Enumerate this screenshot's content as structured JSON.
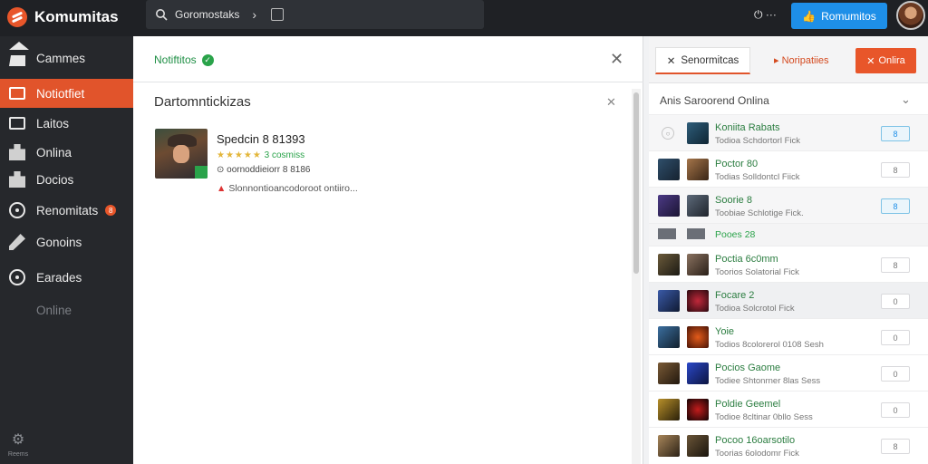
{
  "topbar": {
    "brand": "Komumitas",
    "search_text": "Goromostaks",
    "search_chevron": "›",
    "icons": [
      "power-icon",
      "more-icon"
    ],
    "icons_text": "⏻ ⋯",
    "primary_button": "Romumitos",
    "accent": "#1e8fe8"
  },
  "sidebar": {
    "items": [
      {
        "label": "Cammes",
        "icon": "home-icon"
      },
      {
        "label": "Notiotfiet",
        "icon": "notes-icon"
      },
      {
        "label": "Laitos",
        "icon": "square-icon"
      },
      {
        "label": "Onlina",
        "icon": "puzzle-icon"
      },
      {
        "label": "Docios",
        "icon": "puzzle-icon"
      },
      {
        "label": "Renomitats",
        "icon": "ring-icon",
        "badge": "8"
      },
      {
        "label": "Gonoins",
        "icon": "pencil-icon"
      },
      {
        "label": "Earades",
        "icon": "circle-icon"
      },
      {
        "label": "Online",
        "icon": ""
      }
    ],
    "settings_label": "Reems",
    "accent": "#e1542b"
  },
  "main": {
    "header_title": "Notiftitos",
    "section_title": "Dartomntickizas",
    "game": {
      "name": "Spedcin 8 81393",
      "stars": "★★★★★",
      "rating_text": "3 cosmiss",
      "meta": "⊙ oornoddieiorr 8 8186",
      "note_icon": "▲",
      "note": "Slonnontioancodoroot ontiiro..."
    }
  },
  "right": {
    "tabs": [
      "Senormitcas",
      "Noripatiies",
      "Onlira"
    ],
    "header": "Anis  Saroorend Onlina",
    "rows": [
      {
        "name": "Koniita Rabats",
        "sub": "Todioa Schdortorl Fick",
        "btn": "8",
        "on": true
      },
      {
        "name": "Poctor 80",
        "sub": "Todias Solldontcl Fiick",
        "btn": "8",
        "on": false
      },
      {
        "name": "Soorie 8",
        "sub": "Toobiae Schlotige Fick.",
        "btn": "8",
        "on": true
      },
      {
        "name": "Poctia 6c0mm",
        "sub": "Toorios Solatorial Fick",
        "btn": "8",
        "on": false
      },
      {
        "name": "Focare 2",
        "sub": "Todioa Solcrotol Fick",
        "btn": "0",
        "on": false
      },
      {
        "name": "Yoie",
        "sub": "Todios 8colorerol 0108 Sesh",
        "btn": "0",
        "on": false
      },
      {
        "name": "Pocios Gaome",
        "sub": "Todiee Shtonrner 8las Sess",
        "btn": "0",
        "on": false
      },
      {
        "name": "Poldie Geemel",
        "sub": "Todioe 8cltinar 0bllo Sess",
        "btn": "0",
        "on": false
      },
      {
        "name": "Pocoo 16oarsotilo",
        "sub": "Toorias 6olodomr Fick",
        "btn": "8",
        "on": false
      }
    ],
    "section_label": "Pooes 28"
  }
}
